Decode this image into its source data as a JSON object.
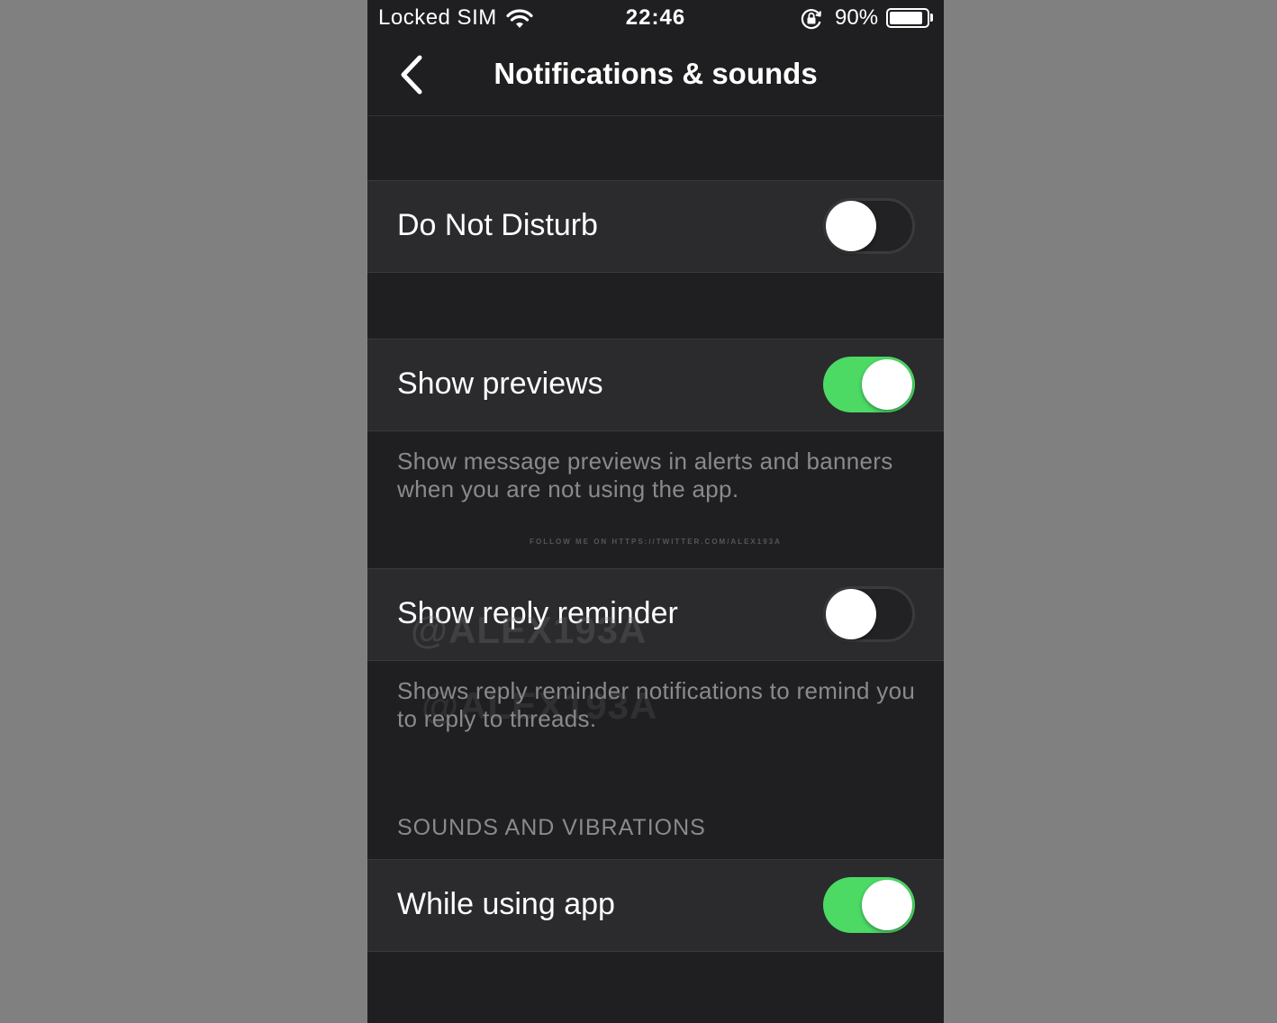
{
  "status_bar": {
    "carrier": "Locked SIM",
    "time": "22:46",
    "battery_percent": "90%",
    "battery_level": 0.9,
    "icons": [
      "wifi-icon",
      "orientation-lock-icon",
      "battery-icon"
    ]
  },
  "nav": {
    "back_icon": "chevron-left-icon",
    "title": "Notifications & sounds"
  },
  "settings": {
    "do_not_disturb": {
      "label": "Do Not Disturb",
      "enabled": false
    },
    "show_previews": {
      "label": "Show previews",
      "enabled": true,
      "footer": "Show message previews in alerts and banners when you are not using the app."
    },
    "show_reply_reminder": {
      "label": "Show reply reminder",
      "enabled": false,
      "footer": "Shows reply reminder notifications to remind you to reply to threads."
    },
    "sounds_section_header": "SOUNDS AND VIBRATIONS",
    "while_using_app": {
      "label": "While using app",
      "enabled": true
    }
  },
  "watermarks": {
    "credit": "FOLLOW ME ON HTTPS://TWITTER.COM/ALEX193A",
    "handle": "@ALEX193A"
  },
  "colors": {
    "toggle_on": "#4cd964",
    "background": "#1f1f21",
    "row_background": "#2b2b2e",
    "secondary_text": "#8a8a8e"
  }
}
